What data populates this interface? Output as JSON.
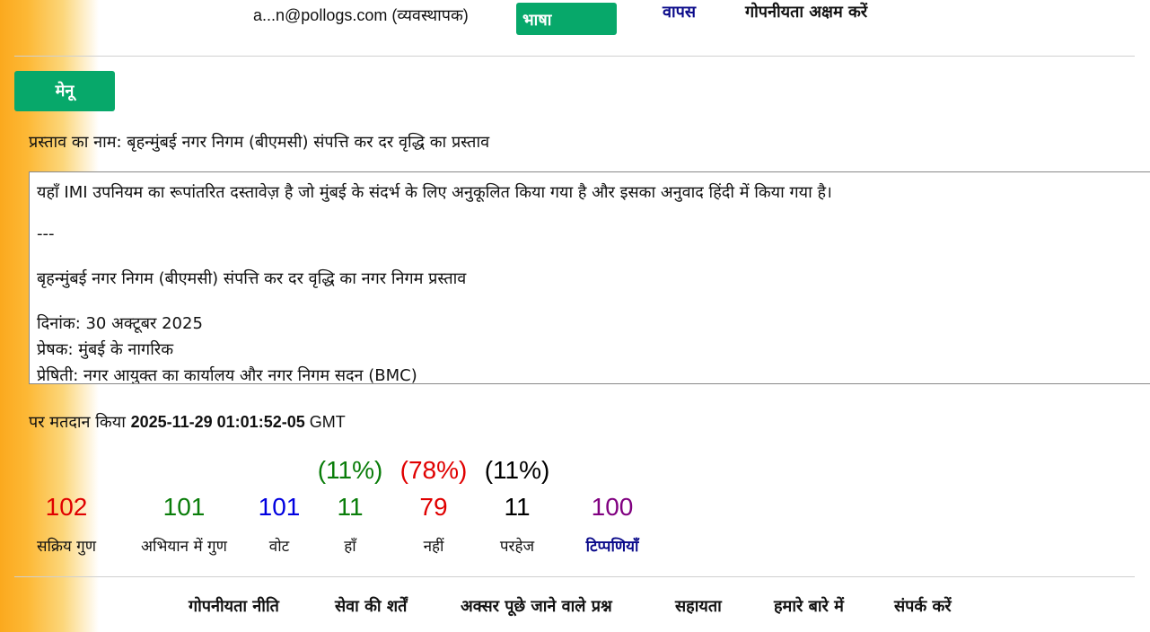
{
  "header": {
    "user": "a...n@pollogs.com (व्यवस्थापक)",
    "language_button": "भाषा",
    "back_link": "वापस",
    "privacy_toggle": "गोपनीयता अक्षम करें"
  },
  "menu_button": "मेनू",
  "proposal": {
    "name_label": "प्रस्ताव का नाम: बृहन्मुंबई नगर निगम (बीएमसी) संपत्ति कर दर वृद्धि का प्रस्ताव",
    "document_lines": [
      "यहाँ IMI उपनियम का रूपांतरित दस्तावेज़ है जो मुंबई के संदर्भ के लिए अनुकूलित किया गया है और इसका अनुवाद हिंदी में किया गया है।",
      "---",
      " बृहन्मुंबई नगर निगम (बीएमसी) संपत्ति कर दर वृद्धि का नगर निगम प्रस्ताव",
      "दिनांक: 30 अक्टूबर 2025",
      "प्रेषक: मुंबई के नागरिक",
      "प्रेषिती: नगर आयुक्त का कार्यालय और नगर निगम सदन (BMC)"
    ]
  },
  "vote_info": {
    "prefix": "पर मतदान किया ",
    "timestamp": "2025-11-29 01:01:52-05",
    "timezone": " GMT"
  },
  "stats": {
    "active_members": {
      "value": "102",
      "label": "सक्रिय गुण",
      "color": "#e00000"
    },
    "campaign_members": {
      "value": "101",
      "label": "अभियान में गुण",
      "color": "#0a7d0a"
    },
    "votes": {
      "value": "101",
      "label": "वोट",
      "color": "#0000e0"
    },
    "yes": {
      "value": "11",
      "pct": "(11%)",
      "label": "हाँ",
      "color": "#0a7d0a"
    },
    "no": {
      "value": "79",
      "pct": "(78%)",
      "label": "नहीं",
      "color": "#e00000"
    },
    "abstain": {
      "value": "11",
      "pct": "(11%)",
      "label": "परहेज",
      "color": "#000000"
    },
    "comments": {
      "value": "100",
      "label": "टिप्पणियाँ",
      "color": "#800080",
      "label_color": "#0a0a8a"
    }
  },
  "footer": {
    "privacy_policy": "गोपनीयता नीति",
    "terms": "सेवा की शर्तें",
    "faq": "अक्सर पूछे जाने वाले प्रश्न",
    "help": "सहायता",
    "about": "हमारे बारे में",
    "contact": "संपर्क करें"
  }
}
